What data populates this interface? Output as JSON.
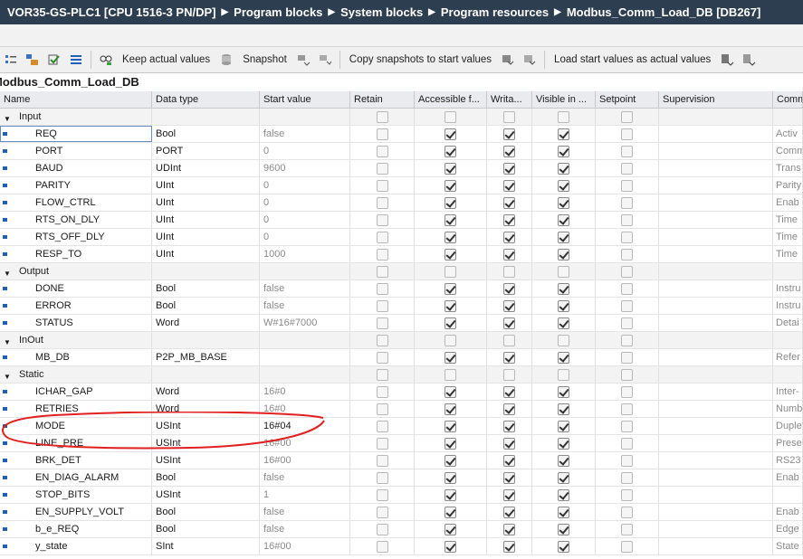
{
  "breadcrumb": [
    "VOR35-GS-PLC1 [CPU 1516-3 PN/DP]",
    "Program blocks",
    "System blocks",
    "Program resources",
    "Modbus_Comm_Load_DB [DB267]"
  ],
  "toolbar": {
    "keep_actual_label": "Keep actual values",
    "snapshot_label": "Snapshot",
    "copy_snapshots_label": "Copy snapshots to start values",
    "load_start_label": "Load start values as actual values"
  },
  "db_title": "Modbus_Comm_Load_DB",
  "columns": [
    "Name",
    "Data type",
    "Start value",
    "Retain",
    "Accessible f...",
    "Writa...",
    "Visible in ...",
    "Setpoint",
    "Supervision",
    "Comm"
  ],
  "rows": [
    {
      "kind": "section",
      "name": "Input",
      "retain": false,
      "acc": false,
      "wri": false,
      "vis": false,
      "set": false
    },
    {
      "kind": "item",
      "name": "REQ",
      "type": "Bool",
      "start": "false",
      "comment": "Activ",
      "retain": false,
      "acc": true,
      "wri": true,
      "vis": true,
      "set": false
    },
    {
      "kind": "item",
      "name": "PORT",
      "type": "PORT",
      "start": "0",
      "comment": "Comm",
      "retain": false,
      "acc": true,
      "wri": true,
      "vis": true,
      "set": false
    },
    {
      "kind": "item",
      "name": "BAUD",
      "type": "UDInt",
      "start": "9600",
      "comment": "Trans",
      "retain": false,
      "acc": true,
      "wri": true,
      "vis": true,
      "set": false
    },
    {
      "kind": "item",
      "name": "PARITY",
      "type": "UInt",
      "start": "0",
      "comment": "Parity",
      "retain": false,
      "acc": true,
      "wri": true,
      "vis": true,
      "set": false
    },
    {
      "kind": "item",
      "name": "FLOW_CTRL",
      "type": "UInt",
      "start": "0",
      "comment": "Enab",
      "retain": false,
      "acc": true,
      "wri": true,
      "vis": true,
      "set": false
    },
    {
      "kind": "item",
      "name": "RTS_ON_DLY",
      "type": "UInt",
      "start": "0",
      "comment": "Time",
      "retain": false,
      "acc": true,
      "wri": true,
      "vis": true,
      "set": false
    },
    {
      "kind": "item",
      "name": "RTS_OFF_DLY",
      "type": "UInt",
      "start": "0",
      "comment": "Time",
      "retain": false,
      "acc": true,
      "wri": true,
      "vis": true,
      "set": false
    },
    {
      "kind": "item",
      "name": "RESP_TO",
      "type": "UInt",
      "start": "1000",
      "comment": "Time",
      "retain": false,
      "acc": true,
      "wri": true,
      "vis": true,
      "set": false
    },
    {
      "kind": "section",
      "name": "Output",
      "retain": false,
      "acc": false,
      "wri": false,
      "vis": false,
      "set": false
    },
    {
      "kind": "item",
      "name": "DONE",
      "type": "Bool",
      "start": "false",
      "comment": "Instru",
      "retain": false,
      "acc": true,
      "wri": true,
      "vis": true,
      "set": false
    },
    {
      "kind": "item",
      "name": "ERROR",
      "type": "Bool",
      "start": "false",
      "comment": "Instru",
      "retain": false,
      "acc": true,
      "wri": true,
      "vis": true,
      "set": false
    },
    {
      "kind": "item",
      "name": "STATUS",
      "type": "Word",
      "start": "W#16#7000",
      "comment": "Detai",
      "retain": false,
      "acc": true,
      "wri": true,
      "vis": true,
      "set": false
    },
    {
      "kind": "section",
      "name": "InOut",
      "retain": false,
      "acc": false,
      "wri": false,
      "vis": false,
      "set": false
    },
    {
      "kind": "item",
      "name": "MB_DB",
      "type": "P2P_MB_BASE",
      "start": "",
      "comment": "Refer",
      "retain": false,
      "acc": true,
      "wri": true,
      "vis": true,
      "set": false
    },
    {
      "kind": "section",
      "name": "Static",
      "retain": false,
      "acc": false,
      "wri": false,
      "vis": false,
      "set": false
    },
    {
      "kind": "item",
      "name": "ICHAR_GAP",
      "type": "Word",
      "start": "16#0",
      "comment": "Inter-",
      "retain": false,
      "acc": true,
      "wri": true,
      "vis": true,
      "set": false
    },
    {
      "kind": "item",
      "name": "RETRIES",
      "type": "Word",
      "start": "16#0",
      "comment": "Numb",
      "retain": false,
      "acc": true,
      "wri": true,
      "vis": true,
      "set": false
    },
    {
      "kind": "item",
      "name": "MODE",
      "type": "USInt",
      "start": "16#04",
      "comment": "Duple",
      "retain": false,
      "acc": true,
      "wri": true,
      "vis": true,
      "set": false,
      "highlight": true
    },
    {
      "kind": "item",
      "name": "LINE_PRE",
      "type": "USInt",
      "start": "16#00",
      "comment": "Prese",
      "retain": false,
      "acc": true,
      "wri": true,
      "vis": true,
      "set": false
    },
    {
      "kind": "item",
      "name": "BRK_DET",
      "type": "USInt",
      "start": "16#00",
      "comment": "RS23",
      "retain": false,
      "acc": true,
      "wri": true,
      "vis": true,
      "set": false
    },
    {
      "kind": "item",
      "name": "EN_DIAG_ALARM",
      "type": "Bool",
      "start": "false",
      "comment": "Enab",
      "retain": false,
      "acc": true,
      "wri": true,
      "vis": true,
      "set": false
    },
    {
      "kind": "item",
      "name": "STOP_BITS",
      "type": "USInt",
      "start": "1",
      "comment": "",
      "retain": false,
      "acc": true,
      "wri": true,
      "vis": true,
      "set": false
    },
    {
      "kind": "item",
      "name": "EN_SUPPLY_VOLT",
      "type": "Bool",
      "start": "false",
      "comment": "Enab",
      "retain": false,
      "acc": true,
      "wri": true,
      "vis": true,
      "set": false
    },
    {
      "kind": "item",
      "name": "b_e_REQ",
      "type": "Bool",
      "start": "false",
      "comment": "Edge",
      "retain": false,
      "acc": true,
      "wri": true,
      "vis": true,
      "set": false
    },
    {
      "kind": "item",
      "name": "y_state",
      "type": "SInt",
      "start": "16#00",
      "comment": "State",
      "retain": false,
      "acc": true,
      "wri": true,
      "vis": true,
      "set": false
    }
  ],
  "colors": {
    "breadcrumb_bg": "#2c3e50",
    "header_bg": "#e9ebee",
    "annotation": "#e02020",
    "bullet": "#1f5fb5"
  }
}
